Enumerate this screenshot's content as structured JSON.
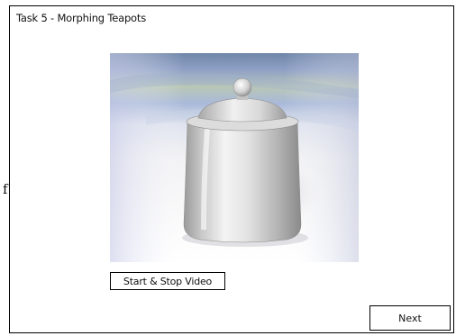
{
  "window": {
    "title": "Task 5 - Morphing Teapots"
  },
  "stray_text": "f",
  "scene": {
    "description_icon": "teapot-3d-render"
  },
  "buttons": {
    "video_label": "Start & Stop Video",
    "next_label": "Next"
  }
}
